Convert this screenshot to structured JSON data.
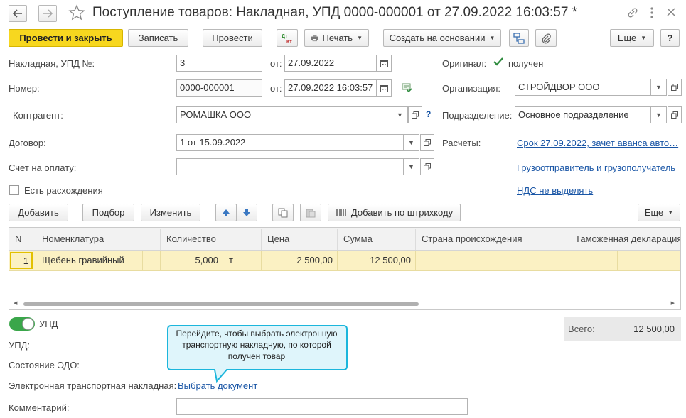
{
  "title": "Поступление товаров: Накладная, УПД 0000-000001 от 27.09.2022 16:03:57 *",
  "toolbar": {
    "post_close": "Провести и закрыть",
    "save": "Записать",
    "post": "Провести",
    "dtkt": "Дт Кт",
    "print": "Печать",
    "create_based": "Создать на основании",
    "more": "Еще",
    "help": "?"
  },
  "form": {
    "invoice_label": "Накладная, УПД №:",
    "invoice_no": "3",
    "from_label": "от:",
    "invoice_date": "27.09.2022",
    "original_label": "Оригинал:",
    "received_label": "получен",
    "number_label": "Номер:",
    "number": "0000-000001",
    "number_date": "27.09.2022 16:03:57",
    "org_label": "Организация:",
    "org": "СТРОЙДВОР ООО",
    "counterparty_label": "Контрагент:",
    "counterparty": "РОМАШКА ООО",
    "division_label": "Подразделение:",
    "division": "Основное подразделение",
    "contract_label": "Договор:",
    "contract": "1 от 15.09.2022",
    "settlements_label": "Расчеты:",
    "settlements_link": "Срок 27.09.2022, зачет аванса авто…",
    "payment_label": "Счет на оплату:",
    "payment_value": "",
    "shipper_link": "Грузоотправитель и грузополучатель",
    "discrepancy_label": "Есть расхождения",
    "vat_link": "НДС не выделять"
  },
  "table_toolbar": {
    "add": "Добавить",
    "select": "Подбор",
    "change": "Изменить",
    "barcode": "Добавить по штрихкоду",
    "more": "Еще"
  },
  "table": {
    "columns": [
      "N",
      "Номенклатура",
      "Количество",
      "Цена",
      "Сумма",
      "Страна происхождения",
      "Таможенная декларация"
    ],
    "rows": [
      {
        "n": "1",
        "item": "Щебень гравийный",
        "qty": "5,000",
        "unit": "т",
        "price": "2 500,00",
        "sum": "12 500,00",
        "country": "",
        "customs": ""
      }
    ]
  },
  "footer": {
    "upd_toggle": "УПД",
    "upd_label": "УПД:",
    "edo_label": "Состояние ЭДО:",
    "etn_label": "Электронная транспортная накладная:",
    "etn_link": "Выбрать документ",
    "comment_label": "Комментарий:",
    "comment_value": "",
    "total_label": "Всего:",
    "total_value": "12 500,00"
  },
  "tooltip": "Перейдите, чтобы выбрать электронную транспортную накладную, по которой получен товар",
  "colors": {
    "primary": "#f7d71f",
    "link": "#1a56a6",
    "selected_row": "#fbf1c3",
    "toggle": "#3aa64a"
  }
}
